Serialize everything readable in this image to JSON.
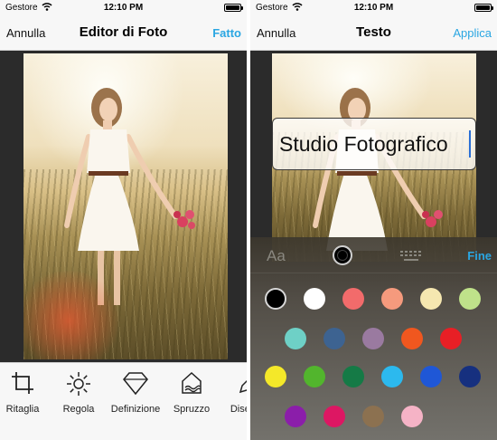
{
  "status": {
    "carrier": "Gestore",
    "time": "12:10 PM"
  },
  "left_screen": {
    "nav": {
      "left": "Annulla",
      "title": "Editor di Foto",
      "right": "Fatto"
    },
    "tools": [
      {
        "label": "Ritaglia",
        "icon": "crop-icon"
      },
      {
        "label": "Regola",
        "icon": "brightness-icon"
      },
      {
        "label": "Definizione",
        "icon": "diamond-icon"
      },
      {
        "label": "Spruzzo",
        "icon": "splash-icon"
      },
      {
        "label": "Disegno",
        "icon": "pencil-icon"
      }
    ]
  },
  "right_screen": {
    "nav": {
      "left": "Annulla",
      "title": "Testo",
      "right": "Applica"
    },
    "text_value": "Studio Fotografico",
    "panel": {
      "font_button": "Aa",
      "done": "Fine",
      "selected_color": "#000000",
      "colors": [
        [
          "#000000",
          "#ffffff",
          "#f26b6b",
          "#f59a7d",
          "#f5e7b0",
          "#bfe28a"
        ],
        [
          "#6ed0c6",
          "#3d6391",
          "#9a7aa0",
          "#f0571f",
          "#e81f25"
        ],
        [
          "#f4e829",
          "#52b52d",
          "#157a46",
          "#2cb9ee",
          "#1f57d6",
          "#16307f"
        ],
        [
          "#8b1eaa",
          "#dd1763",
          "#8c7150",
          "#f5b3c6"
        ]
      ]
    }
  }
}
